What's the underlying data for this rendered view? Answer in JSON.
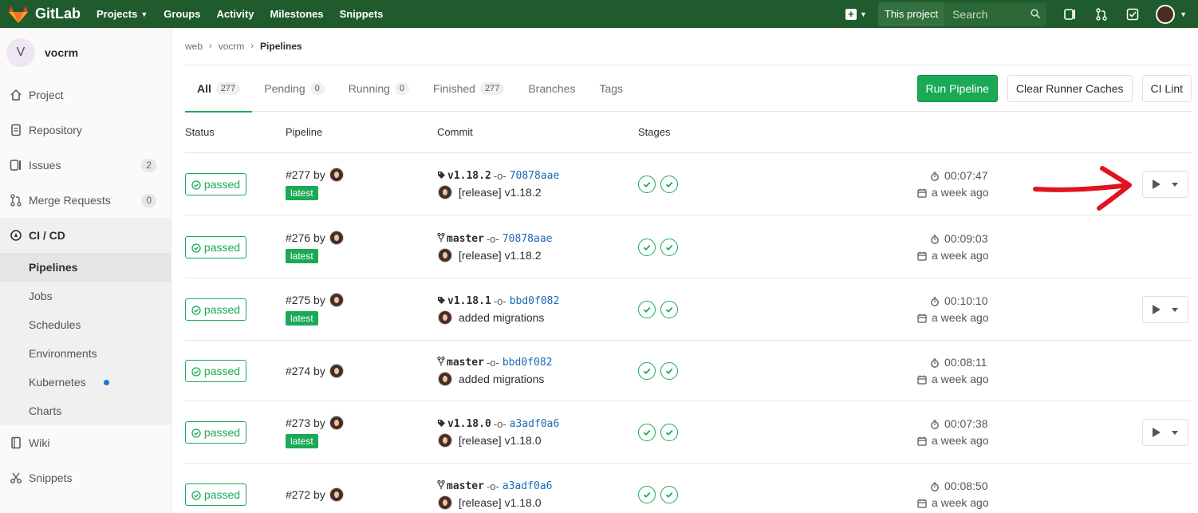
{
  "navbar": {
    "brand": "GitLab",
    "links": [
      {
        "label": "Projects",
        "caret": true
      },
      {
        "label": "Groups"
      },
      {
        "label": "Activity"
      },
      {
        "label": "Milestones"
      },
      {
        "label": "Snippets"
      }
    ],
    "search_scope": "This project",
    "search_placeholder": "Search",
    "accent": "#1f5b2c"
  },
  "sidebar": {
    "project_initial": "V",
    "project_name": "vocrm",
    "items": [
      {
        "label": "Project",
        "icon": "home-icon"
      },
      {
        "label": "Repository",
        "icon": "doc-icon"
      },
      {
        "label": "Issues",
        "icon": "issues-icon",
        "count": "2"
      },
      {
        "label": "Merge Requests",
        "icon": "merge-request-icon",
        "count": "0"
      },
      {
        "label": "CI / CD",
        "icon": "rocket-icon",
        "active": true
      }
    ],
    "subitems": [
      "Pipelines",
      "Jobs",
      "Schedules",
      "Environments",
      "Kubernetes",
      "Charts"
    ],
    "bottom_items": [
      {
        "label": "Wiki",
        "icon": "book-icon"
      },
      {
        "label": "Snippets",
        "icon": "scissors-icon"
      }
    ]
  },
  "breadcrumb": [
    "web",
    "vocrm",
    "Pipelines"
  ],
  "tabs": [
    {
      "label": "All",
      "count": "277",
      "active": true
    },
    {
      "label": "Pending",
      "count": "0"
    },
    {
      "label": "Running",
      "count": "0"
    },
    {
      "label": "Finished",
      "count": "277"
    },
    {
      "label": "Branches"
    },
    {
      "label": "Tags"
    }
  ],
  "buttons": {
    "run": "Run Pipeline",
    "clear": "Clear Runner Caches",
    "lint": "CI Lint"
  },
  "columns": {
    "status": "Status",
    "pipeline": "Pipeline",
    "commit": "Commit",
    "stages": "Stages"
  },
  "by_label": "by",
  "pipelines": [
    {
      "status": "passed",
      "id": "#277",
      "latest": "latest",
      "ref_type": "tag",
      "ref": "v1.18.2",
      "sha": "70878aae",
      "message": "[release] v1.18.2",
      "duration": "00:07:47",
      "finished": "a week ago",
      "has_play": true
    },
    {
      "status": "passed",
      "id": "#276",
      "latest": "latest",
      "ref_type": "branch",
      "ref": "master",
      "sha": "70878aae",
      "message": "[release] v1.18.2",
      "duration": "00:09:03",
      "finished": "a week ago",
      "has_play": false
    },
    {
      "status": "passed",
      "id": "#275",
      "latest": "latest",
      "ref_type": "tag",
      "ref": "v1.18.1",
      "sha": "bbd0f082",
      "message": "added migrations",
      "duration": "00:10:10",
      "finished": "a week ago",
      "has_play": true
    },
    {
      "status": "passed",
      "id": "#274",
      "latest": "",
      "ref_type": "branch",
      "ref": "master",
      "sha": "bbd0f082",
      "message": "added migrations",
      "duration": "00:08:11",
      "finished": "a week ago",
      "has_play": false
    },
    {
      "status": "passed",
      "id": "#273",
      "latest": "latest",
      "ref_type": "tag",
      "ref": "v1.18.0",
      "sha": "a3adf0a6",
      "message": "[release] v1.18.0",
      "duration": "00:07:38",
      "finished": "a week ago",
      "has_play": true
    },
    {
      "status": "passed",
      "id": "#272",
      "latest": "",
      "ref_type": "branch",
      "ref": "master",
      "sha": "a3adf0a6",
      "message": "[release] v1.18.0",
      "duration": "00:08:50",
      "finished": "a week ago",
      "has_play": false
    }
  ],
  "colors": {
    "success": "#1aaa55",
    "link": "#1b69b6",
    "annotation": "#e0141e"
  }
}
